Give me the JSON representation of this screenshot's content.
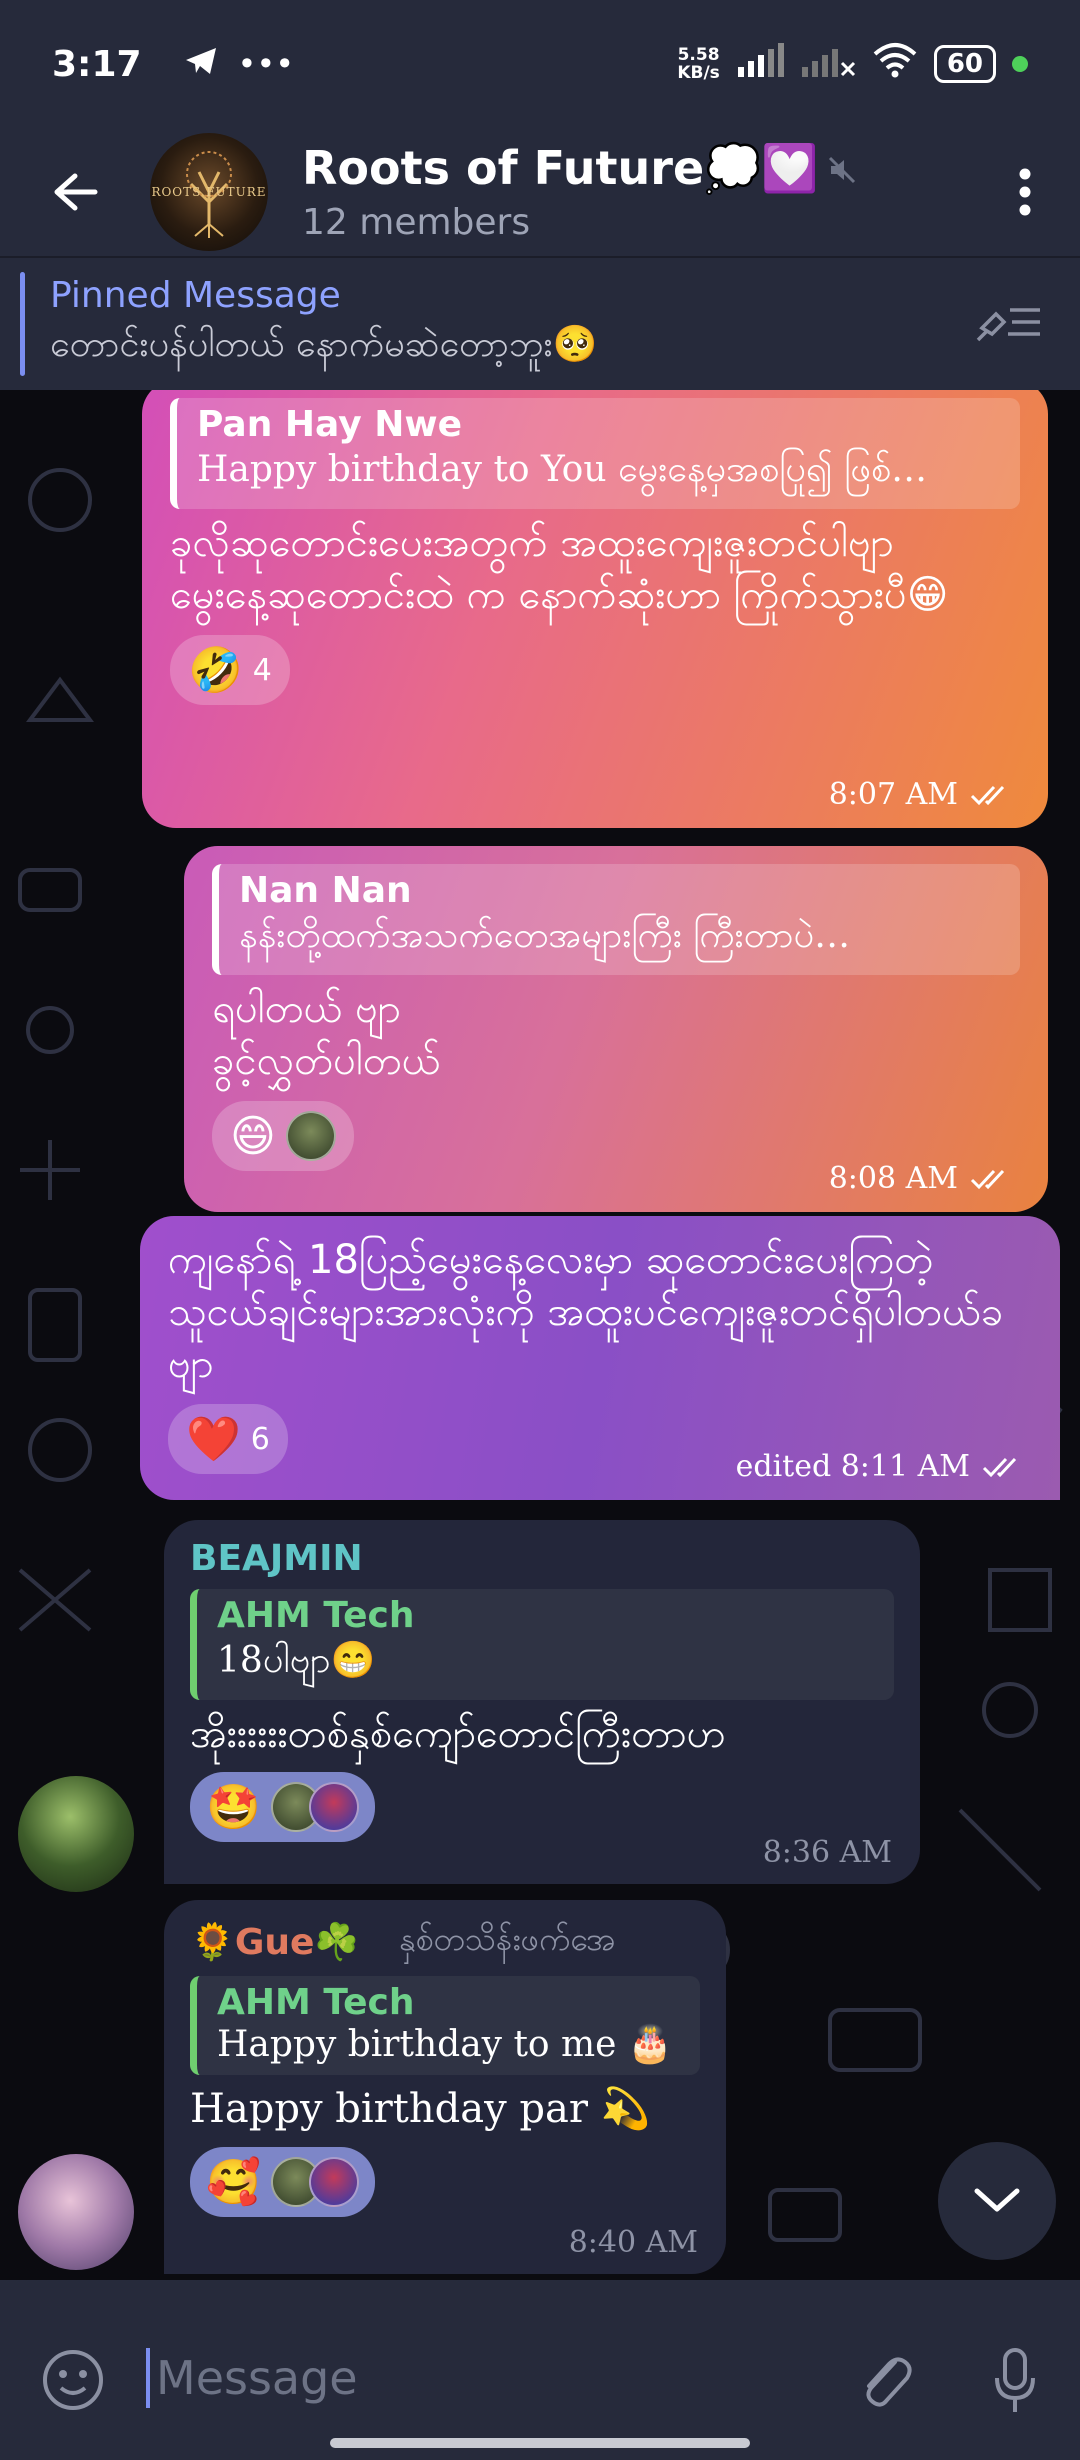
{
  "status_bar": {
    "time": "3:17",
    "speed_value": "5.58",
    "speed_unit": "KB/s",
    "battery": "60"
  },
  "header": {
    "title": "Roots of Future💭💟",
    "members": "12 members",
    "avatar_text": "ROOTS  FUTURE"
  },
  "pinned": {
    "title": "Pinned Message",
    "text": "တောင်းပန်ပါတယ် နောက်မဆဲတော့ဘူး🥺"
  },
  "messages": [
    {
      "reply_name": "Pan Hay Nwe",
      "reply_text": "Happy birthday to You မွေးနေ့မှအစပြု၍ ဖြစ်…",
      "text_1": "ခုလိုဆုတောင်းပေးအတွက် အထူးကျေးဇူးတင်ပါဗျာ",
      "text_2": "မွေးနေ့ဆုတောင်းထဲ က နောက်ဆုံးဟာ ကြိုက်သွားပီ😁",
      "reaction_emoji": "🤣",
      "reaction_count": "4",
      "time": "8:07 AM"
    },
    {
      "reply_name": "Nan Nan",
      "reply_text": "နန်းတို့ထက်အသက်တေအများကြီး ကြီးတာပဲ…",
      "text_1": "ရပါတယ် ဗျာ",
      "text_2": "ခွင့်လွှတ်ပါတယ်",
      "reaction_emoji": "😄",
      "time": "8:08 AM"
    },
    {
      "text": "ကျနော်ရဲ့ 18ပြည့်မွေးနေ့လေးမှာ ဆုတောင်းပေးကြတဲ့ သူငယ်ချင်းများအားလုံးကို အထူးပင်ကျေးဇူးတင်ရှိပါတယ်ခဗျာ",
      "reaction_emoji": "❤️",
      "reaction_count": "6",
      "time": "edited 8:11 AM"
    },
    {
      "sender": "BEAJMIN",
      "sender_color": "#5fc4c6",
      "reply_name": "AHM Tech",
      "reply_text": "18ပါဗျာ😁",
      "text": "အိုးးးးးးတစ်နှစ်ကျော်တောင်ကြီးတာဟ",
      "reaction_emoji": "🤩",
      "time": "8:36 AM"
    },
    {
      "sender": "🌻Gue☘️",
      "sender_color": "#e07a5f",
      "sender_status": "နှစ်တသိန်းဖက်အေ",
      "reply_name": "AHM Tech",
      "reply_text": "Happy birthday  to me 🎂",
      "text": "Happy birthday par 💫",
      "reaction_emoji": "🥰",
      "time": "8:40 AM"
    }
  ],
  "input": {
    "placeholder": "Message"
  },
  "colors": {
    "header_bg": "#262a3b",
    "accent": "#7b8ef0",
    "incoming_bubble": "#23263a"
  }
}
